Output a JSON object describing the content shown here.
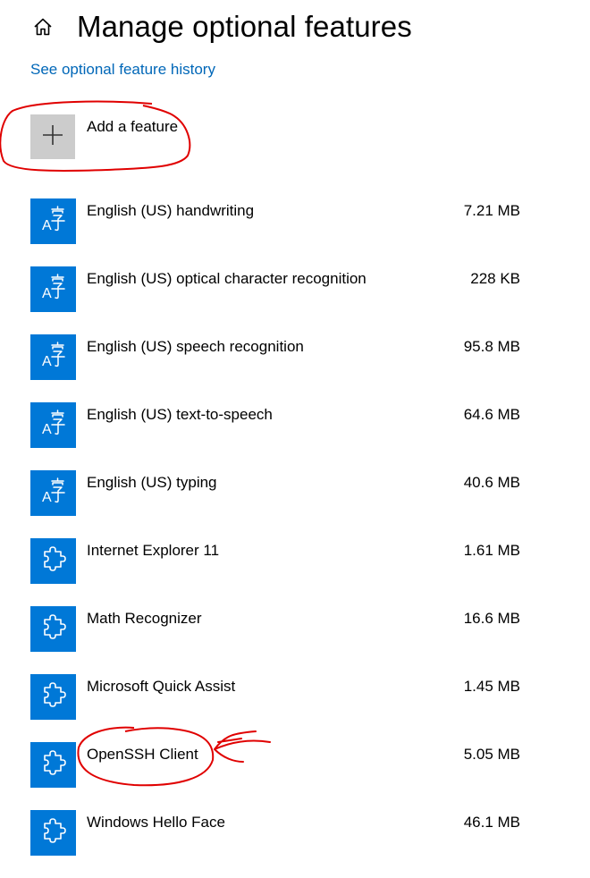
{
  "header": {
    "home_icon": "home-icon",
    "title": "Manage optional features"
  },
  "history_link": "See optional feature history",
  "add_feature": {
    "icon": "plus-icon",
    "label": "Add a feature"
  },
  "features": [
    {
      "name": "English (US) handwriting",
      "size": "7.21 MB",
      "icon": "language-icon"
    },
    {
      "name": "English (US) optical character recognition",
      "size": "228 KB",
      "icon": "language-icon"
    },
    {
      "name": "English (US) speech recognition",
      "size": "95.8 MB",
      "icon": "language-icon"
    },
    {
      "name": "English (US) text-to-speech",
      "size": "64.6 MB",
      "icon": "language-icon"
    },
    {
      "name": "English (US) typing",
      "size": "40.6 MB",
      "icon": "language-icon"
    },
    {
      "name": "Internet Explorer 11",
      "size": "1.61 MB",
      "icon": "puzzle-icon"
    },
    {
      "name": "Math Recognizer",
      "size": "16.6 MB",
      "icon": "puzzle-icon"
    },
    {
      "name": "Microsoft Quick Assist",
      "size": "1.45 MB",
      "icon": "puzzle-icon"
    },
    {
      "name": "OpenSSH Client",
      "size": "5.05 MB",
      "icon": "puzzle-icon"
    },
    {
      "name": "Windows Hello Face",
      "size": "46.1 MB",
      "icon": "puzzle-icon"
    }
  ],
  "colors": {
    "accent": "#0078d7",
    "link": "#0067b8",
    "add_tile": "#cccccc",
    "annotation": "#e00000"
  }
}
